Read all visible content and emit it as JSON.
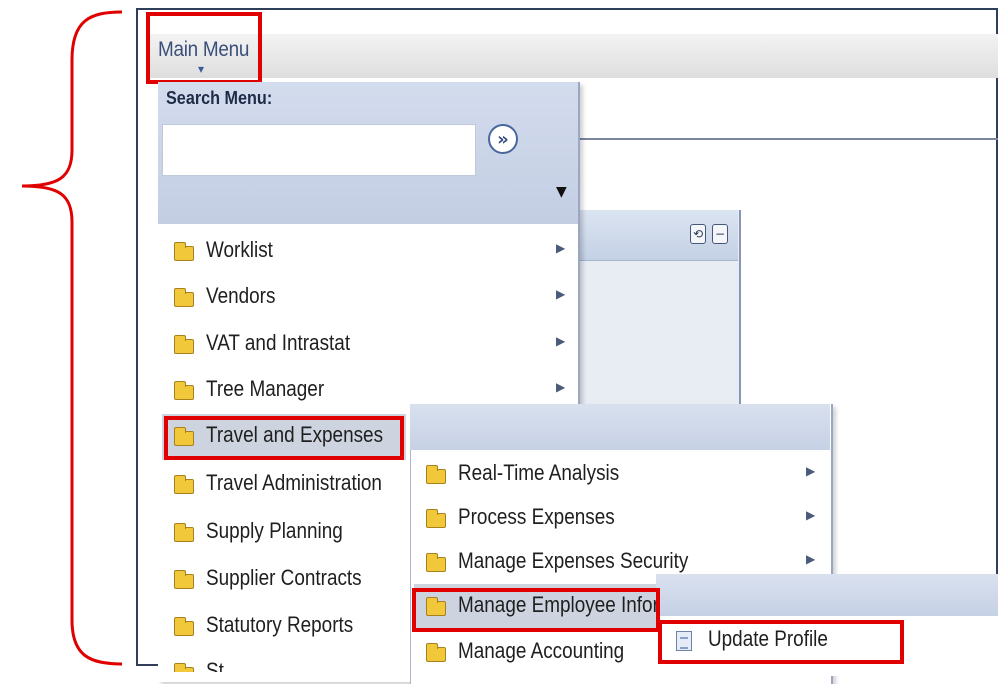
{
  "header": {
    "main_menu_label": "Main Menu"
  },
  "search": {
    "label": "Search Menu:",
    "value": "",
    "go_symbol": "»"
  },
  "pagelet": {
    "refresh_symbol": "⟲",
    "minimize_symbol": "−"
  },
  "menu_level1": {
    "items": [
      {
        "label": "Worklist",
        "has_submenu": true
      },
      {
        "label": "Vendors",
        "has_submenu": true
      },
      {
        "label": "VAT and Intrastat",
        "has_submenu": true
      },
      {
        "label": "Tree Manager",
        "has_submenu": true
      },
      {
        "label": "Travel and Expenses",
        "has_submenu": true,
        "highlighted": true
      },
      {
        "label": "Travel Administration",
        "has_submenu": false
      },
      {
        "label": "Supply Planning",
        "has_submenu": false
      },
      {
        "label": "Supplier Contracts",
        "has_submenu": false
      },
      {
        "label": "Statutory Reports",
        "has_submenu": false
      },
      {
        "label": "St",
        "has_submenu": false
      }
    ]
  },
  "menu_level2": {
    "items": [
      {
        "label": "Real-Time Analysis",
        "has_submenu": true
      },
      {
        "label": "Process Expenses",
        "has_submenu": true
      },
      {
        "label": "Manage Expenses Security",
        "has_submenu": true
      },
      {
        "label": "Manage Employee Inform",
        "has_submenu": false,
        "highlighted": true
      },
      {
        "label": "Manage Accounting",
        "has_submenu": false
      }
    ]
  },
  "menu_level3": {
    "items": [
      {
        "label": "Update Profile",
        "highlighted": true
      }
    ]
  },
  "colors": {
    "highlight": "#e00000",
    "menu_band": "#c8d3e6",
    "folder": "#f0c83a"
  }
}
